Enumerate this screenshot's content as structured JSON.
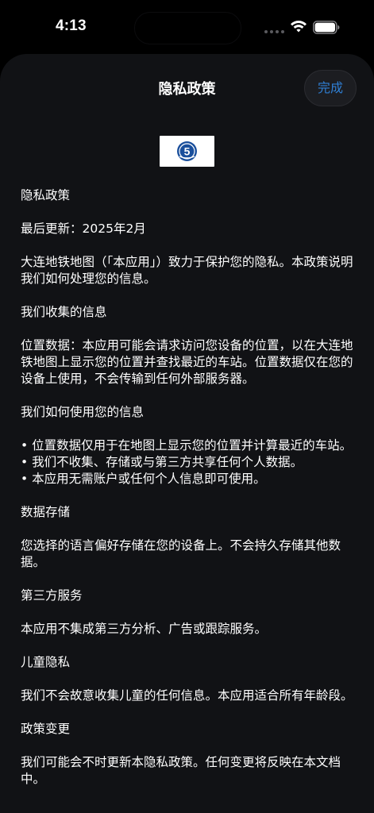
{
  "status_bar": {
    "time": "4:13"
  },
  "nav": {
    "title": "隐私政策",
    "done_label": "完成"
  },
  "logo": {
    "icon": "dalian-metro-logo",
    "text": "5"
  },
  "policy": {
    "heading": "隐私政策",
    "updated": "最后更新：2025年2月",
    "intro": "大连地铁地图（「本应用」）致力于保护您的隐私。本政策说明我们如何处理您的信息。",
    "collect_heading": "我们收集的信息",
    "collect_body": "位置数据：本应用可能会请求访问您设备的位置，以在大连地铁地图上显示您的位置并查找最近的车站。位置数据仅在您的设备上使用，不会传输到任何外部服务器。",
    "use_heading": "我们如何使用您的信息",
    "use_bullet_1": "• 位置数据仅用于在地图上显示您的位置并计算最近的车站。",
    "use_bullet_2": "• 我们不收集、存储或与第三方共享任何个人数据。",
    "use_bullet_3": "• 本应用无需账户或任何个人信息即可使用。",
    "storage_heading": "数据存储",
    "storage_body": "您选择的语言偏好存储在您的设备上。不会持久存储其他数据。",
    "third_party_heading": "第三方服务",
    "third_party_body": "本应用不集成第三方分析、广告或跟踪服务。",
    "children_heading": "儿童隐私",
    "children_body": "我们不会故意收集儿童的任何信息。本应用适合所有年龄段。",
    "changes_heading": "政策变更",
    "changes_body": "我们可能会不时更新本隐私政策。任何变更将反映在本文档中。"
  },
  "colors": {
    "sheet_background": "#111215",
    "accent": "#2f7fd4",
    "logo_blue": "#1a4f9c"
  }
}
